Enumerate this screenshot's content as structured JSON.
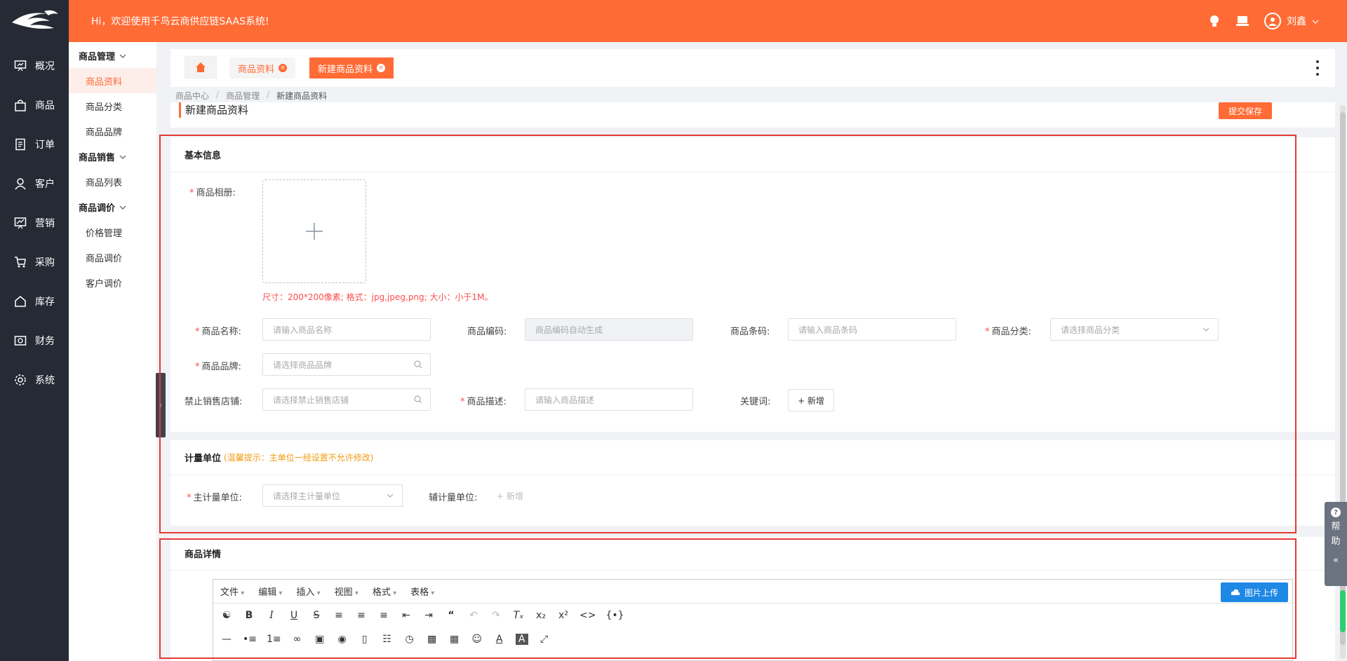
{
  "header": {
    "welcome": "Hi，欢迎使用千鸟云商供应链SAAS系统!",
    "user_name": "刘鑫"
  },
  "leftnav": [
    {
      "label": "概况",
      "icon": "overview-icon"
    },
    {
      "label": "商品",
      "icon": "bag-icon"
    },
    {
      "label": "订单",
      "icon": "order-icon"
    },
    {
      "label": "客户",
      "icon": "user-icon"
    },
    {
      "label": "营销",
      "icon": "marketing-icon"
    },
    {
      "label": "采购",
      "icon": "cart-icon"
    },
    {
      "label": "库存",
      "icon": "home-icon"
    },
    {
      "label": "财务",
      "icon": "finance-icon"
    },
    {
      "label": "系统",
      "icon": "gear-icon"
    }
  ],
  "submenu": {
    "groups": [
      {
        "title": "商品管理",
        "items": [
          "商品资料",
          "商品分类",
          "商品品牌"
        ]
      },
      {
        "title": "商品销售",
        "items": [
          "商品列表"
        ]
      },
      {
        "title": "商品调价",
        "items": [
          "价格管理",
          "商品调价",
          "客户调价"
        ]
      }
    ]
  },
  "tabs": {
    "tab1": "商品资料",
    "tab2": "新建商品资料"
  },
  "breadcrumb": [
    "商品中心",
    "商品管理",
    "新建商品资料"
  ],
  "page": {
    "title": "新建商品资料",
    "submit": "提交保存"
  },
  "basic": {
    "title": "基本信息",
    "album_label": "商品相册:",
    "upload_hint": "尺寸：200*200像素; 格式：jpg,jpeg,png; 大小：小于1M。",
    "name_label": "商品名称:",
    "name_placeholder": "请输入商品名称",
    "code_label": "商品编码:",
    "code_placeholder": "商品编码自动生成",
    "barcode_label": "商品条码:",
    "barcode_placeholder": "请输入商品条码",
    "category_label": "商品分类:",
    "category_placeholder": "请选择商品分类",
    "brand_label": "商品品牌:",
    "brand_placeholder": "请选择商品品牌",
    "shop_label": "禁止销售店铺:",
    "shop_placeholder": "请选择禁止销售店铺",
    "desc_label": "商品描述:",
    "desc_placeholder": "请输入商品描述",
    "keyword_label": "关键词:",
    "keyword_add": "+ 新增"
  },
  "unit": {
    "title": "计量单位",
    "hint": "(温馨提示：主单位一经设置不允许修改)",
    "main_label": "主计量单位:",
    "main_placeholder": "请选择主计量单位",
    "aux_label": "辅计量单位:",
    "aux_add": "+ 新增"
  },
  "detail": {
    "title": "商品详情",
    "menus": [
      "文件",
      "编辑",
      "插入",
      "视图",
      "格式",
      "表格"
    ],
    "upload_btn": "图片上传"
  },
  "help": {
    "line1": "帮",
    "line2": "助"
  }
}
